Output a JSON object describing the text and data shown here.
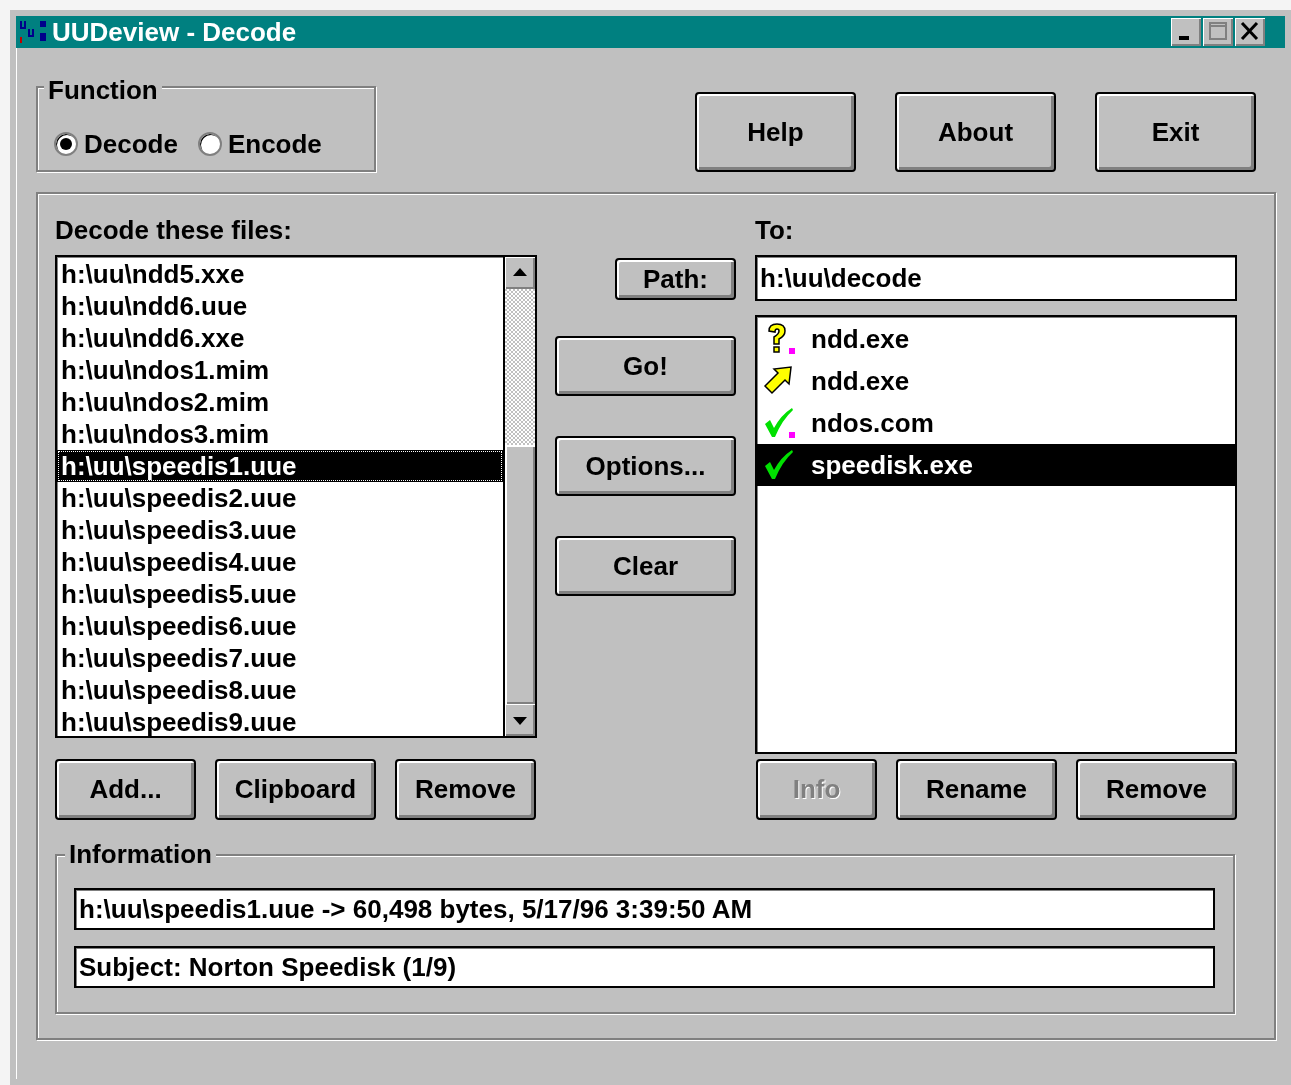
{
  "window": {
    "title": "UUDeview - Decode"
  },
  "function_group": {
    "label": "Function",
    "options": [
      {
        "label": "Decode",
        "selected": true
      },
      {
        "label": "Encode",
        "selected": false
      }
    ]
  },
  "top_buttons": [
    {
      "label": "Help"
    },
    {
      "label": "About"
    },
    {
      "label": "Exit"
    }
  ],
  "source": {
    "label": "Decode these files:",
    "files": [
      {
        "name": "h:\\uu\\ndd5.xxe",
        "selected": false
      },
      {
        "name": "h:\\uu\\ndd6.uue",
        "selected": false
      },
      {
        "name": "h:\\uu\\ndd6.xxe",
        "selected": false
      },
      {
        "name": "h:\\uu\\ndos1.mim",
        "selected": false
      },
      {
        "name": "h:\\uu\\ndos2.mim",
        "selected": false
      },
      {
        "name": "h:\\uu\\ndos3.mim",
        "selected": false
      },
      {
        "name": "h:\\uu\\speedis1.uue",
        "selected": true
      },
      {
        "name": "h:\\uu\\speedis2.uue",
        "selected": false
      },
      {
        "name": "h:\\uu\\speedis3.uue",
        "selected": false
      },
      {
        "name": "h:\\uu\\speedis4.uue",
        "selected": false
      },
      {
        "name": "h:\\uu\\speedis5.uue",
        "selected": false
      },
      {
        "name": "h:\\uu\\speedis6.uue",
        "selected": false
      },
      {
        "name": "h:\\uu\\speedis7.uue",
        "selected": false
      },
      {
        "name": "h:\\uu\\speedis8.uue",
        "selected": false
      },
      {
        "name": "h:\\uu\\speedis9.uue",
        "selected": false
      }
    ],
    "buttons": [
      {
        "label": "Add..."
      },
      {
        "label": "Clipboard"
      },
      {
        "label": "Remove"
      }
    ]
  },
  "path_button": {
    "label": "Path:"
  },
  "actions": [
    {
      "label": "Go!"
    },
    {
      "label": "Options..."
    },
    {
      "label": "Clear"
    }
  ],
  "target": {
    "label": "To:",
    "path": "h:\\uu\\decode",
    "files": [
      {
        "name": "ndd.exe",
        "kind": "question",
        "flagged": true,
        "selected": false
      },
      {
        "name": "ndd.exe",
        "kind": "arrow",
        "flagged": false,
        "selected": false
      },
      {
        "name": "ndos.com",
        "kind": "check",
        "flagged": true,
        "selected": false
      },
      {
        "name": "speedisk.exe",
        "kind": "check",
        "flagged": false,
        "selected": true
      }
    ],
    "buttons": [
      {
        "label": "Info",
        "disabled": true
      },
      {
        "label": "Rename",
        "disabled": false
      },
      {
        "label": "Remove",
        "disabled": false
      }
    ]
  },
  "information": {
    "label": "Information",
    "lines": [
      "h:\\uu\\speedis1.uue -> 60,498 bytes, 5/17/96 3:39:50 AM",
      "Subject: Norton Speedisk (1/9)"
    ]
  }
}
